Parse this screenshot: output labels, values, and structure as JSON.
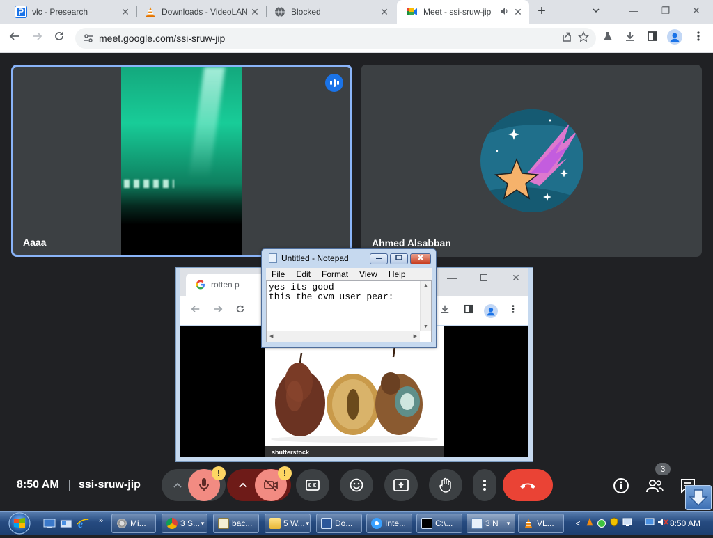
{
  "browser": {
    "tabs": [
      {
        "title": "vlc - Presearch",
        "favicon": "presearch-icon",
        "active": false
      },
      {
        "title": "Downloads - VideoLAN",
        "favicon": "vlc-cone-icon",
        "active": false
      },
      {
        "title": "Blocked",
        "favicon": "globe-icon",
        "active": false
      },
      {
        "title": "Meet - ssi-sruw-jip",
        "favicon": "meet-icon",
        "active": true,
        "audio": true
      }
    ],
    "url": "meet.google.com/ssi-sruw-jip",
    "close_symbol": "✕",
    "new_tab_symbol": "+",
    "tab_menu_symbol": "⌄",
    "window_controls": {
      "minimize": "—",
      "restore": "❐",
      "close": "✕"
    }
  },
  "meet": {
    "participants": [
      {
        "name": "Aaaa",
        "speaking": true
      },
      {
        "name": "Ahmed Alsabban",
        "speaking": false
      }
    ],
    "time": "8:50 AM",
    "meeting_code": "ssi-sruw-jip",
    "warning_badge": "!",
    "participant_count": "3",
    "colors": {
      "accent": "#8ab4f8",
      "end_call": "#ea4335",
      "muted": "#f28b82",
      "tile": "#3c4043",
      "bg": "#202124"
    }
  },
  "shared_window": {
    "tab_title": "rotten p",
    "image_watermark": "shutterstock"
  },
  "notepad": {
    "title": "Untitled - Notepad",
    "menu": [
      "File",
      "Edit",
      "Format",
      "View",
      "Help"
    ],
    "text": "yes its good\nthis the cvm user pear:"
  },
  "taskbar": {
    "items": [
      {
        "label": "Mi...",
        "icon": "gear-icon"
      },
      {
        "label": "3 S...",
        "icon": "chrome-icon",
        "dropdown": true
      },
      {
        "label": "bac...",
        "icon": "document-icon"
      },
      {
        "label": "5 W...",
        "icon": "folder-icon",
        "dropdown": true
      },
      {
        "label": "Do...",
        "icon": "word-icon"
      },
      {
        "label": "Inte...",
        "icon": "ie-icon"
      },
      {
        "label": "C:\\...",
        "icon": "cmd-icon"
      },
      {
        "label": "3 N",
        "icon": "notepad-icon",
        "dropdown": true
      },
      {
        "label": "VL...",
        "icon": "vlc-cone-icon"
      }
    ],
    "clock": "8:50 AM",
    "tray_chevron": "<"
  }
}
